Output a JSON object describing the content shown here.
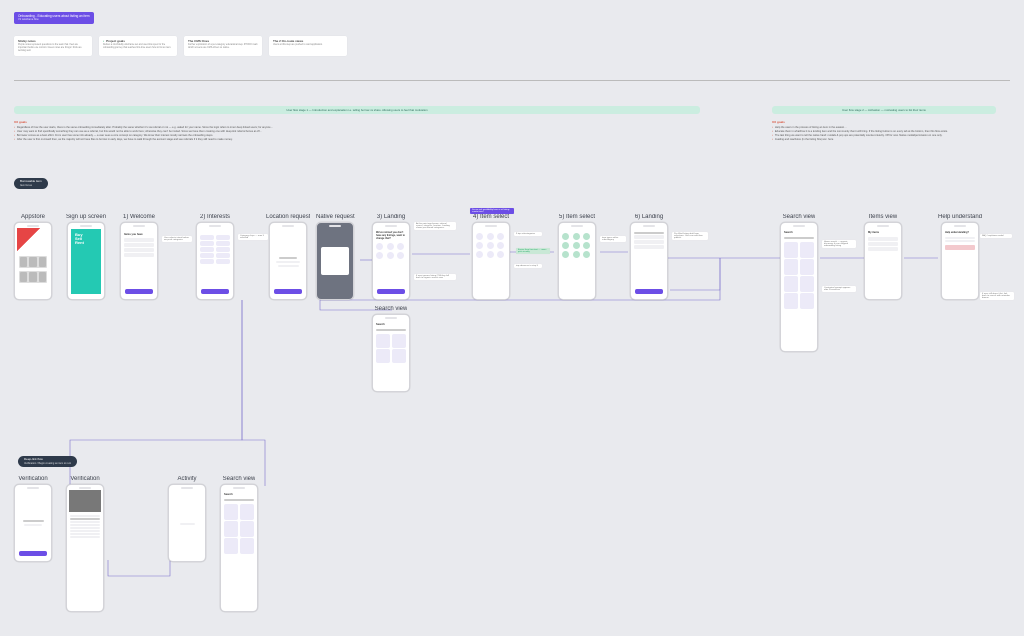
{
  "header": {
    "title": "Onboarding - Educating users about listing an item",
    "subtitle": "V1 wireframe flow"
  },
  "notes": [
    {
      "title": "Sticky notes",
      "body": "Purple notes represent questions to the team that I feel are important before we commit. Green notes are things I think are working well."
    },
    {
      "title": "Project goals",
      "body": "Deliver a mid-fidelity wireframe set and user-flow spec for the onboarding journey that teaches first-time users how to list an item."
    },
    {
      "title": "The CMS Ones",
      "body": "Further exploration of a per-category educational step. #TODO mark which screens are CMS-driven vs native."
    },
    {
      "title": "The 2 On-route views",
      "body": "Users at this step are pushed to card application."
    }
  ],
  "stage1": {
    "bar": "User flow stage 1 — Introduction and explanation i.e. telling borrow vs share. Allowing users to feel that motivation",
    "goals_title": "UX goals",
    "goals": [
      "Regardless of how the user starts, there is the same onboarding immediately after. Probably the same whether it’s via referral or not — e.g. asked for your name. Since the logic refers to inner deep linked users; for anyone…",
      "User may want to find specifically something they can use as a referral, but this would not be able to work here; otherwise they can’t be invited. Since we have them creating one with deep-link referral bonus at off…",
      "Borrower comes as a best effort. From user has some info already — a user sees a core concept on category. We know their interest mostly narrows the onboarding steps.",
      "After the user is first on-board then, as the majority will not have files to borrow in early days, we have to walk through the account stage and see referrals if it they still need to make money."
    ]
  },
  "stage2": {
    "bar": "User flow stage 2 — Activation — motivating users to list their items",
    "goals_title": "UX goals",
    "goals": [
      "Help the users in the process of listing an item in the easiest…",
      "Educate them in what/how it is a lending item and the community that it will bring. If the listing button is on every tab at the bottom, then this flow exists.",
      "The last thing we want to tell the native hand: modals & pop ups are potentially counter-intuivity. Off for now. Native modal/permission on one only.",
      "Availing and reachoice (in the listing flow) etc. here"
    ]
  },
  "section_badges": {
    "borrow": {
      "title": "Borrowable item",
      "sub": "Item list as"
    },
    "deep": {
      "title": "Deep-link flow",
      "sub": "Verification / Begin creating an item to rent"
    }
  },
  "screens_row1": [
    {
      "id": "appstore",
      "label": "Appstore"
    },
    {
      "id": "signup",
      "label": "Sign up screen"
    },
    {
      "id": "welcome",
      "label": "1) Welcome"
    },
    {
      "id": "interests",
      "label": "2) Interests"
    },
    {
      "id": "location",
      "label": "Location request"
    },
    {
      "id": "native",
      "label": "Native request"
    },
    {
      "id": "landing",
      "label": "3) Landing"
    },
    {
      "id": "itemsel",
      "label": "4) Item select"
    },
    {
      "id": "itemsel2",
      "label": "5) Item select"
    },
    {
      "id": "landing2",
      "label": "6) Landing"
    }
  ],
  "search_view": {
    "label": "Search view"
  },
  "screens_stage2": [
    {
      "id": "searchv2",
      "label": "Search view"
    },
    {
      "id": "itemsv",
      "label": "Items view"
    },
    {
      "id": "helpu",
      "label": "Help understand"
    }
  ],
  "screens_deeplink": [
    {
      "id": "verif1",
      "label": "Verification"
    },
    {
      "id": "verif2",
      "label": "Verification"
    },
    {
      "id": "activity",
      "label": "Activity"
    },
    {
      "id": "searchv3",
      "label": "Search view"
    }
  ],
  "inlabels": {
    "welcome_h": "Items you have",
    "landing_q": "We've noticed you don't have any listings, want to change that?",
    "search_h": "Search",
    "items_h": "My items",
    "help_h": "Help understanding?"
  }
}
